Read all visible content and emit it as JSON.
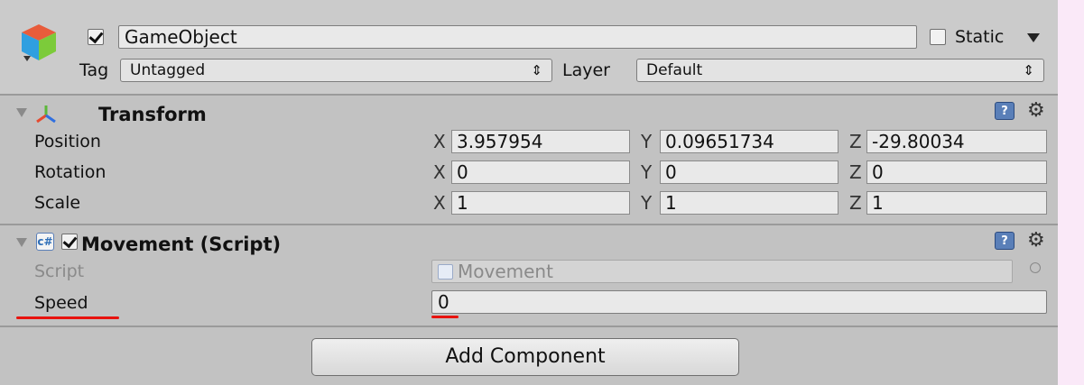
{
  "header": {
    "active": true,
    "name": "GameObject",
    "static_label": "Static",
    "static_checked": false,
    "tag_label": "Tag",
    "tag_value": "Untagged",
    "layer_label": "Layer",
    "layer_value": "Default"
  },
  "transform": {
    "title": "Transform",
    "rows": [
      {
        "label": "Position",
        "x": "3.957954",
        "y": "0.09651734",
        "z": "-29.80034"
      },
      {
        "label": "Rotation",
        "x": "0",
        "y": "0",
        "z": "0"
      },
      {
        "label": "Scale",
        "x": "1",
        "y": "1",
        "z": "1"
      }
    ],
    "axis": {
      "x": "X",
      "y": "Y",
      "z": "Z"
    }
  },
  "movement": {
    "title": "Movement (Script)",
    "enabled": true,
    "script_label": "Script",
    "script_value": "Movement",
    "speed_label": "Speed",
    "speed_value": "0"
  },
  "add_component_label": "Add Component",
  "colors": {
    "annotation_red": "#e8130e",
    "help_blue": "#5a7fb8"
  }
}
